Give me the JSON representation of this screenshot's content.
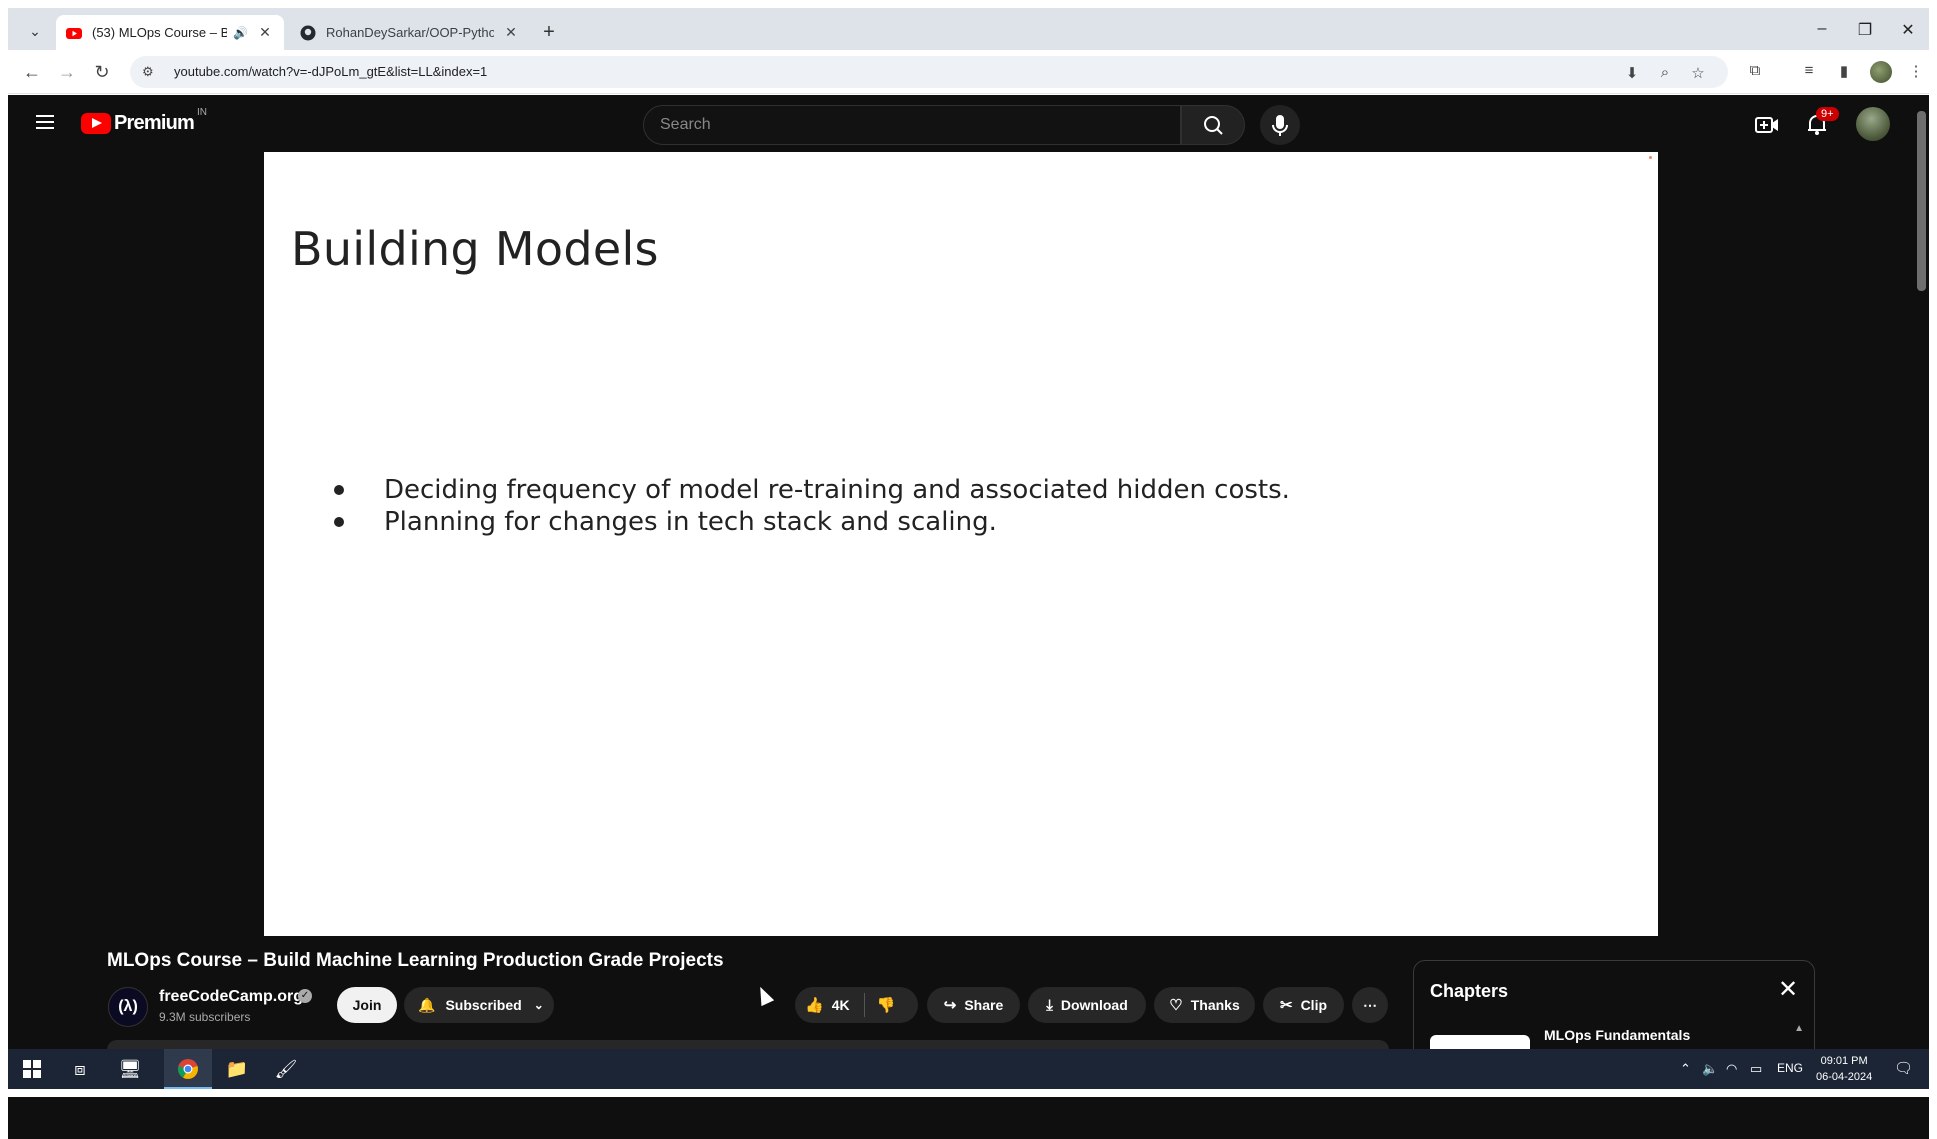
{
  "browser": {
    "tabs": [
      {
        "title": "(53) MLOps Course – Build",
        "active": true
      },
      {
        "title": "RohanDeySarkar/OOP-Python",
        "active": false
      }
    ],
    "url": "youtube.com/watch?v=-dJPoLm_gtE&list=LL&index=1"
  },
  "youtube": {
    "logo_text": "Premium",
    "region": "IN",
    "search_placeholder": "Search",
    "notification_count": "9+"
  },
  "slide": {
    "title": "Building Models",
    "bullets": [
      "Deciding frequency of model re-training and associated hidden costs.",
      "Planning for changes in tech stack and scaling."
    ]
  },
  "video": {
    "title": "MLOps Course – Build Machine Learning Production Grade Projects",
    "channel": "freeCodeCamp.org",
    "subscribers": "9.3M subscribers",
    "join_label": "Join",
    "subscribed_label": "Subscribed",
    "like_count": "4K",
    "share_label": "Share",
    "download_label": "Download",
    "thanks_label": "Thanks",
    "clip_label": "Clip"
  },
  "chapters": {
    "header": "Chapters",
    "first_item": "MLOps Fundamentals"
  },
  "taskbar": {
    "language": "ENG",
    "time": "09:01 PM",
    "date": "06-04-2024"
  },
  "colors": {
    "yt_background": "#0f0f0f",
    "yt_red": "#ff0000",
    "tabstrip": "#dee3ea",
    "taskbar": "#1b2535"
  }
}
